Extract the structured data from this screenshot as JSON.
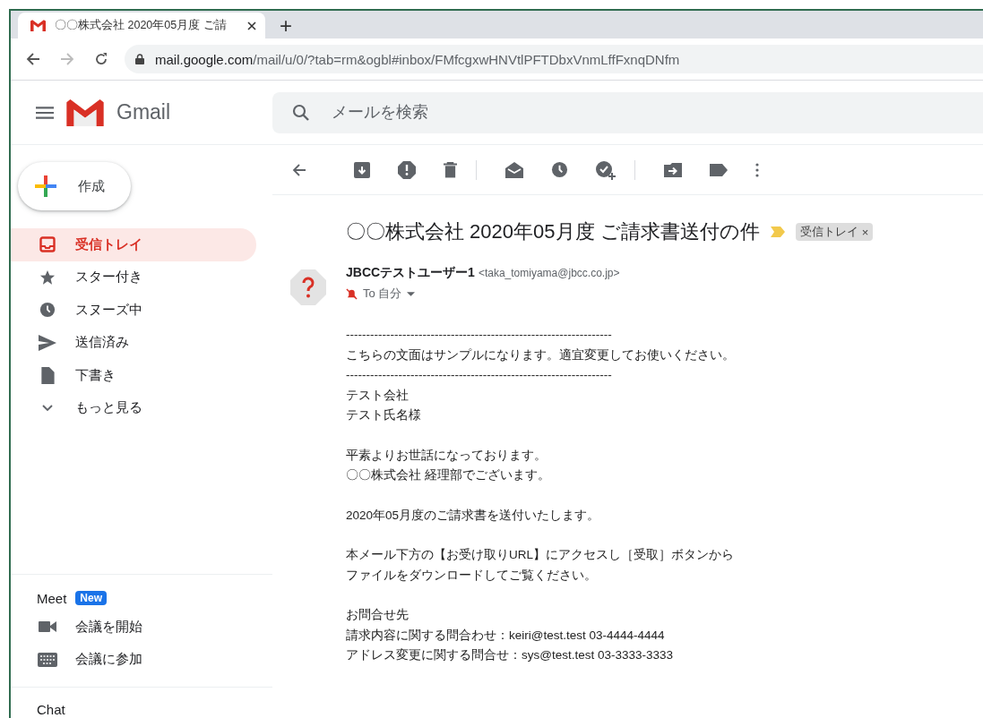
{
  "browser": {
    "tab_title": "〇〇株式会社 2020年05月度 ご請",
    "new_tab": "+",
    "url_host": "mail.google.com",
    "url_path": "/mail/u/0/?tab=rm&ogbl#inbox/FMfcgxwHNVtlPFTDbxVnmLffFxnqDNfm"
  },
  "app": {
    "name": "Gmail"
  },
  "search": {
    "placeholder": "メールを検索"
  },
  "compose": {
    "label": "作成"
  },
  "sidebar": {
    "items": [
      {
        "label": "受信トレイ",
        "selected": true
      },
      {
        "label": "スター付き",
        "selected": false
      },
      {
        "label": "スヌーズ中",
        "selected": false
      },
      {
        "label": "送信済み",
        "selected": false
      },
      {
        "label": "下書き",
        "selected": false
      },
      {
        "label": "もっと見る",
        "selected": false
      }
    ]
  },
  "meet": {
    "title": "Meet",
    "badge": "New",
    "items": [
      {
        "label": "会議を開始"
      },
      {
        "label": "会議に参加"
      }
    ]
  },
  "chat": {
    "title": "Chat"
  },
  "message": {
    "subject": "〇〇株式会社 2020年05月度 ご請求書送付の件",
    "label_chip": "受信トレイ",
    "chip_close": "×",
    "sender_name": "JBCCテストユーザー1",
    "sender_email": "<taka_tomiyama@jbcc.co.jp>",
    "recipient": "To 自分",
    "body": [
      [
        "------------------------------------------------------------------",
        "こちらの文面はサンプルになります。適宜変更してお使いください。",
        "------------------------------------------------------------------",
        "テスト会社",
        "テスト氏名様"
      ],
      [
        "平素よりお世話になっております。",
        "〇〇株式会社 経理部でございます。"
      ],
      [
        "2020年05月度のご請求書を送付いたします。"
      ],
      [
        "本メール下方の【お受け取りURL】にアクセスし［受取］ボタンから",
        "ファイルをダウンロードしてご覧ください。"
      ],
      [
        "お問合せ先",
        "請求内容に関する問合わせ：keiri@test.test 03-4444-4444",
        "アドレス変更に関する問合せ：sys@test.test 03-3333-3333"
      ]
    ]
  }
}
